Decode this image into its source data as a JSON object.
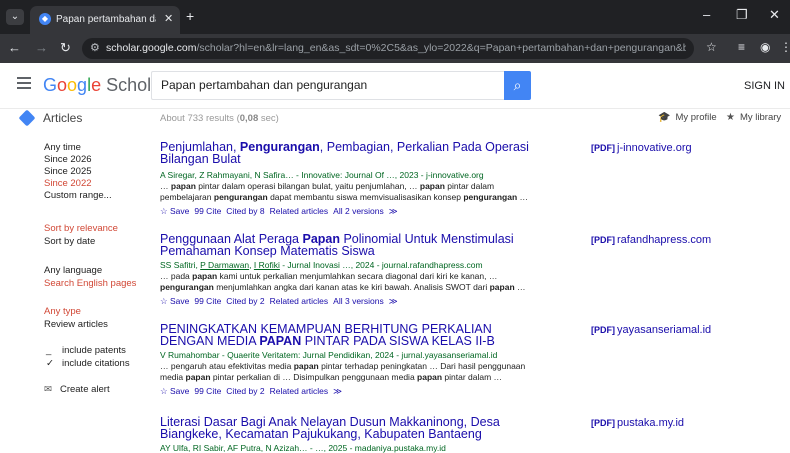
{
  "browser": {
    "tab_title": "Papan pertambahan dan pengu",
    "url_domain": "scholar.google.com",
    "url_rest": "/scholar?hl=en&lr=lang_en&as_sdt=0%2C5&as_ylo=2022&q=Papan+pertambahan+dan+pengurangan&btnG="
  },
  "header": {
    "logo_google": [
      "G",
      "o",
      "o",
      "g",
      "l",
      "e"
    ],
    "logo_scholar": "Scholar",
    "search_value": "Papan pertambahan dan pengurangan",
    "sign_in": "SIGN IN"
  },
  "subbar": {
    "section": "Articles",
    "results_prefix": "About 733 results (",
    "results_time": "0,08",
    "results_suffix": " sec)",
    "my_profile": "My profile",
    "my_library": "My library"
  },
  "sidebar": {
    "time": [
      "Any time",
      "Since 2026",
      "Since 2025",
      "Since 2022",
      "Custom range..."
    ],
    "sort": [
      "Sort by relevance",
      "Sort by date"
    ],
    "language": [
      "Any language",
      "Search English pages"
    ],
    "type": [
      "Any type",
      "Review articles"
    ],
    "include_patents": "include patents",
    "include_citations": "include citations",
    "create_alert": "Create alert"
  },
  "results": [
    {
      "t1": "Penjumlahan, ",
      "t2": "Pengurangan",
      "t3": ", Pembagian, Perkalian Pada Operasi Bilangan Bulat",
      "authors": "A Siregar, Z Rahmayani, N Safira… - Innovative: Journal Of …, 2023 - j-innovative.org",
      "snip1_a": "… ",
      "snip1_b": "papan",
      "snip1_c": " pintar dalam operasi bilangan bulat, yaitu penjumlahan, … ",
      "snip1_d": "papan",
      "snip1_e": " pintar dalam",
      "snip2_a": "pembelajaran ",
      "snip2_b": "pengurangan",
      "snip2_c": " dapat membantu siswa memvisualisasikan konsep ",
      "snip2_d": "pengurangan",
      "snip2_e": " …",
      "links": [
        "☆ Save",
        "99 Cite",
        "Cited by 8",
        "Related articles",
        "All 2 versions",
        "≫"
      ],
      "pdf_tag": "[PDF]",
      "pdf_source": "j-innovative.org"
    },
    {
      "t1": "Penggunaan Alat Peraga ",
      "t2": "Papan",
      "t3": " Polinomial Untuk Menstimulasi Pemahaman Konsep Matematis Siswa",
      "authors_u1": "SS Safitri",
      "authors_s1": ", ",
      "authors_u2": "P Darmawan",
      "authors_s2": ", ",
      "authors_u3": "I Rofiki",
      "authors_rest": " - Jurnal Inovasi …, 2024 - journal.rafandhapress.com",
      "snip1_a": "… pada ",
      "snip1_b": "papan",
      "snip1_c": " kami untuk perkalian menjumlahkan secara diagonal dari kiri ke kanan, …",
      "snip2_a": "",
      "snip2_b": "pengurangan",
      "snip2_c": " menjumlahkan angka dari kanan atas ke kiri bawah. Analisis SWOT dari ",
      "snip2_d": "papan",
      "snip2_e": " …",
      "links": [
        "☆ Save",
        "99 Cite",
        "Cited by 2",
        "Related articles",
        "All 3 versions",
        "≫"
      ],
      "pdf_tag": "[PDF]",
      "pdf_source": "rafandhapress.com"
    },
    {
      "t1": "PENINGKATKAN KEMAMPUAN BERHITUNG PERKALIAN DENGAN MEDIA ",
      "t2": "PAPAN",
      "t3": " PINTAR PADA SISWA KELAS II-B",
      "authors": "V Rumahombar - Quaerite Veritatem: Jurnal Pendidikan, 2024 - jurnal.yayasanseriamal.id",
      "snip1_a": "… pengaruh atau efektivitas media ",
      "snip1_b": "papan",
      "snip1_c": " pintar terhadap peningkatan … Dari hasil penggunaan",
      "snip2_a": "media ",
      "snip2_b": "papan",
      "snip2_c": " pintar perkalian di … Disimpulkan penggunaan media ",
      "snip2_d": "papan",
      "snip2_e": " pintar dalam …",
      "links": [
        "☆ Save",
        "99 Cite",
        "Cited by 2",
        "Related articles",
        "≫"
      ],
      "pdf_tag": "[PDF]",
      "pdf_source": "yayasanseriamal.id"
    },
    {
      "t1": "Literasi Dasar Bagi Anak Nelayan Dusun Makkaninong, Desa Biangkeke, Kecamatan Pajukukang, Kabupaten Bantaeng",
      "authors": "AY Ulfa, RI Sabir, AF Putra, N Azizah… - …, 2025 - madaniya.pustaka.my.id",
      "pdf_tag": "[PDF]",
      "pdf_source": "pustaka.my.id"
    }
  ]
}
